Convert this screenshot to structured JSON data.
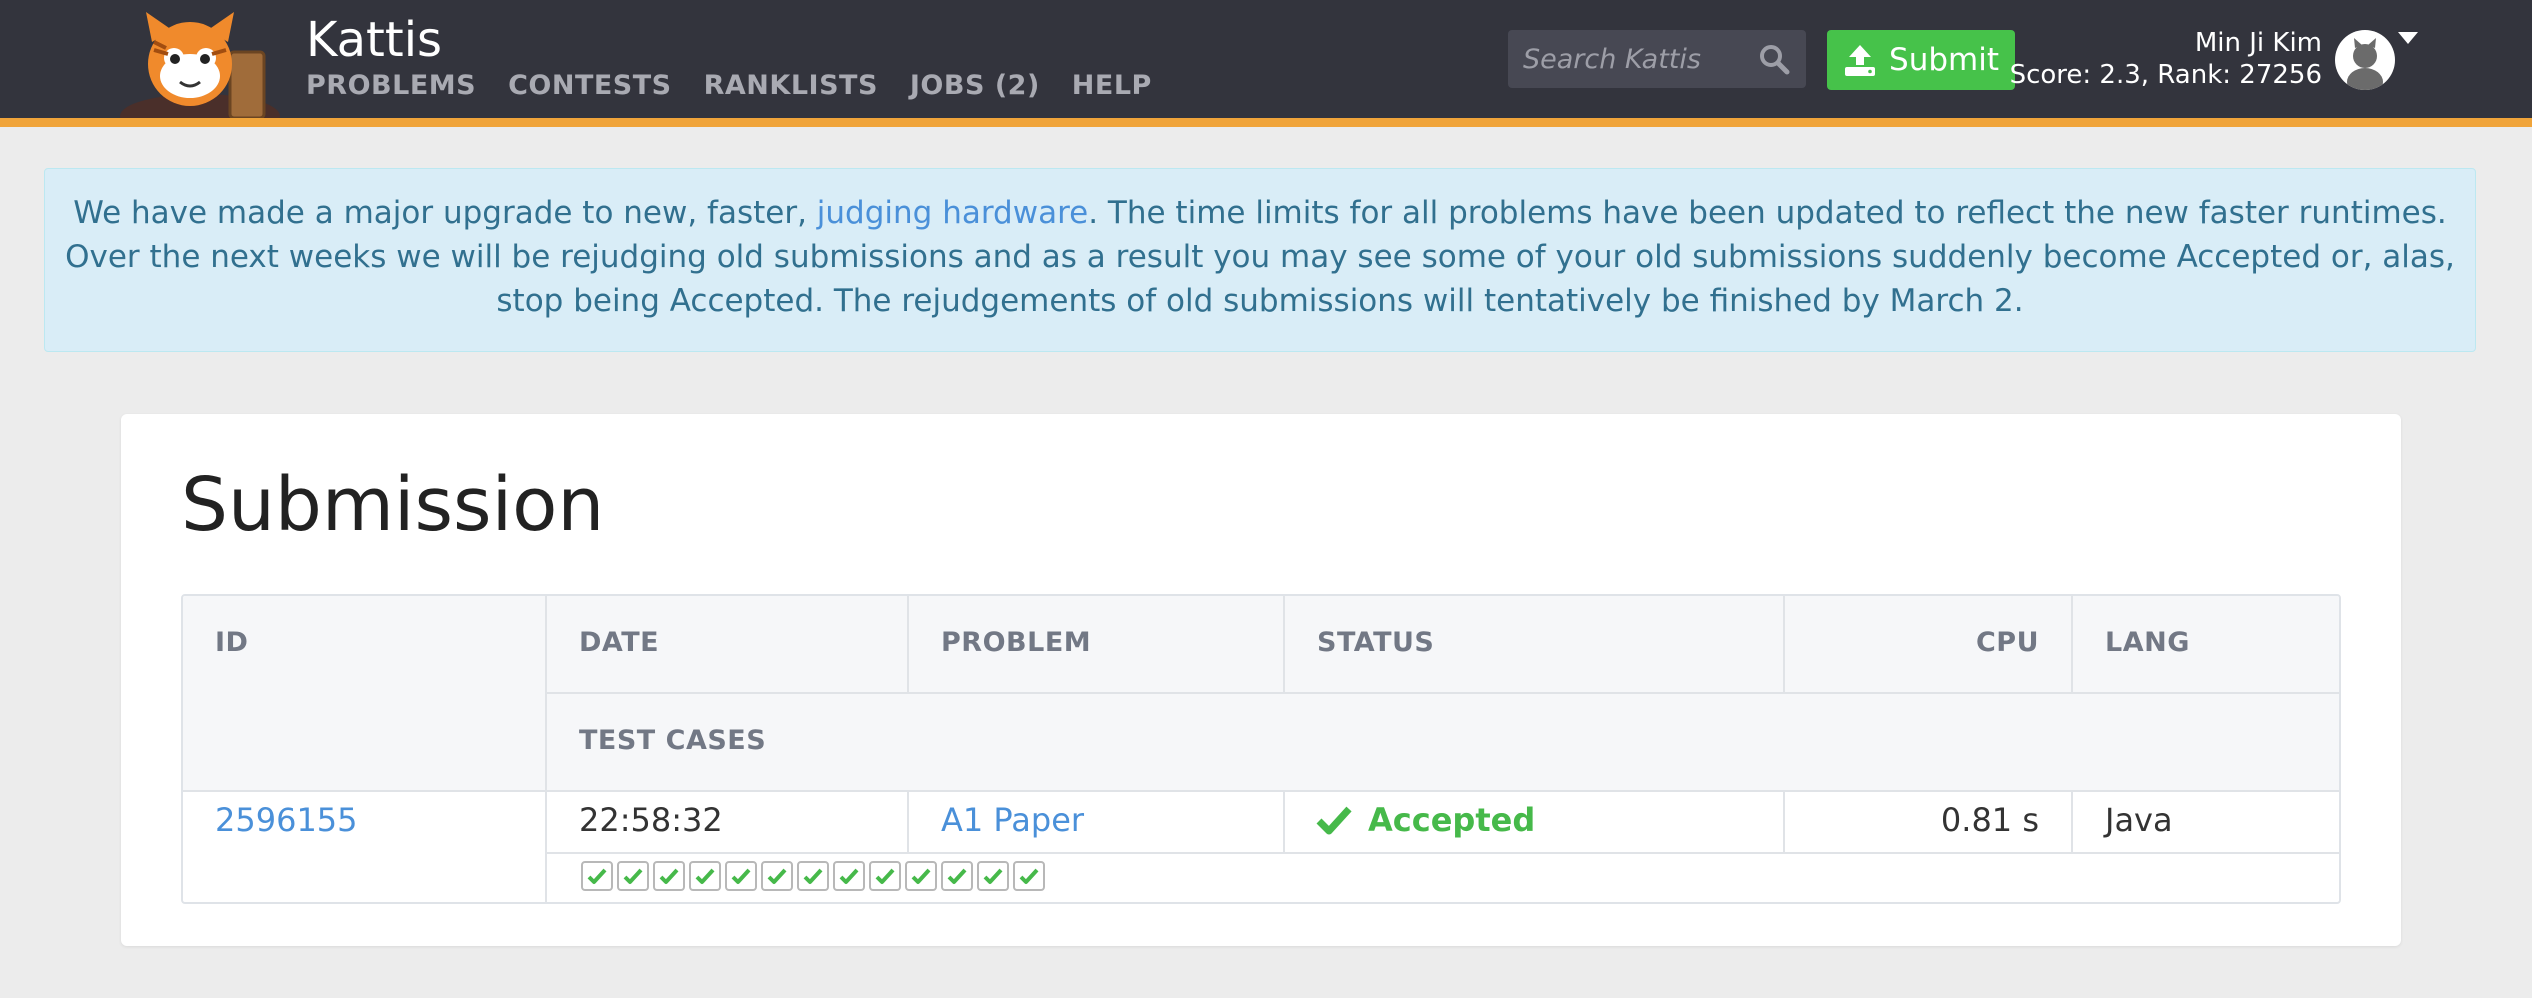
{
  "header": {
    "brand": "Kattis",
    "nav": [
      "PROBLEMS",
      "CONTESTS",
      "RANKLISTS",
      "JOBS (2)",
      "HELP"
    ],
    "search_placeholder": "Search Kattis",
    "submit_label": "Submit",
    "user": {
      "name": "Min Ji Kim",
      "score_rank": "Score: 2.3, Rank: 27256"
    }
  },
  "banner": {
    "text_before": "We have made a major upgrade to new, faster, ",
    "link_text": "judging hardware",
    "text_after": ". The time limits for all problems have been updated to reflect the new faster runtimes. Over the next weeks we will be rejudging old submissions and as a result you may see some of your old submissions suddenly become Accepted or, alas, stop being Accepted. The rejudgements of old submissions will tentatively be finished by March 2."
  },
  "submission": {
    "title": "Submission",
    "headers": {
      "id": "ID",
      "date": "DATE",
      "problem": "PROBLEM",
      "status": "STATUS",
      "cpu": "CPU",
      "lang": "LANG",
      "test_cases": "TEST CASES"
    },
    "row": {
      "id": "2596155",
      "date": "22:58:32",
      "problem": "A1 Paper",
      "status": "Accepted",
      "cpu": "0.81 s",
      "lang": "Java",
      "test_cases_passed": 13
    }
  },
  "colors": {
    "topbar": "#33343d",
    "accent_stripe": "#f0a43a",
    "submit_green": "#46c24a",
    "accepted_green": "#46b94a",
    "link_blue": "#4a90d9",
    "banner_bg": "#d9edf7"
  },
  "icons": [
    "kattis-cat-logo",
    "search-icon",
    "upload-icon",
    "avatar-icon",
    "caret-down-icon",
    "check-icon"
  ]
}
